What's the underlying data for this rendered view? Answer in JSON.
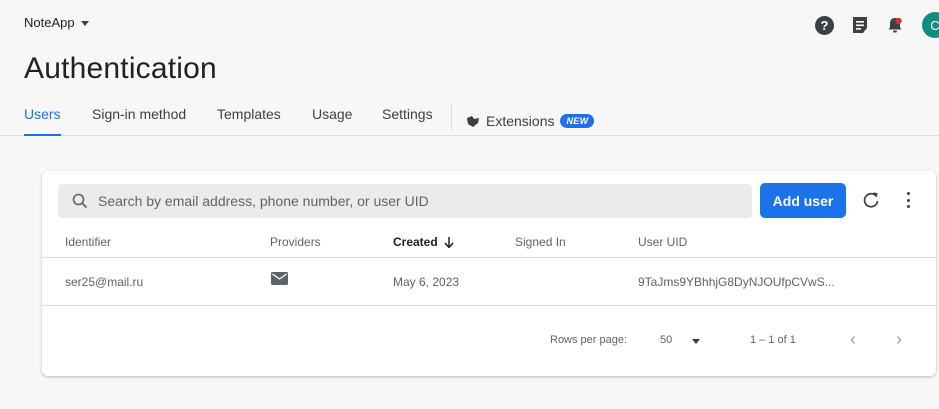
{
  "project": {
    "name": "NoteApp"
  },
  "header": {
    "title": "Authentication",
    "avatar_initial": "C"
  },
  "tabs": [
    {
      "label": "Users"
    },
    {
      "label": "Sign-in method"
    },
    {
      "label": "Templates"
    },
    {
      "label": "Usage"
    },
    {
      "label": "Settings"
    },
    {
      "label": "Extensions",
      "badge": "NEW"
    }
  ],
  "search": {
    "placeholder": "Search by email address, phone number, or user UID"
  },
  "toolbar": {
    "add_user_label": "Add user"
  },
  "table": {
    "columns": [
      "Identifier",
      "Providers",
      "Created",
      "Signed In",
      "User UID"
    ],
    "rows": [
      {
        "identifier": "ser25@mail.ru",
        "provider_icon": "mail-icon",
        "created": "May 6, 2023",
        "signed_in": "",
        "uid": "9TaJms9YBhhjG8DyNJOUfpCVwS..."
      }
    ]
  },
  "pagination": {
    "rows_per_page_label": "Rows per page:",
    "rows_per_page": "50",
    "range": "1 – 1 of 1"
  },
  "colors": {
    "accent": "#1a73e8",
    "avatar": "#0f8f82",
    "alert": "#d93025"
  }
}
